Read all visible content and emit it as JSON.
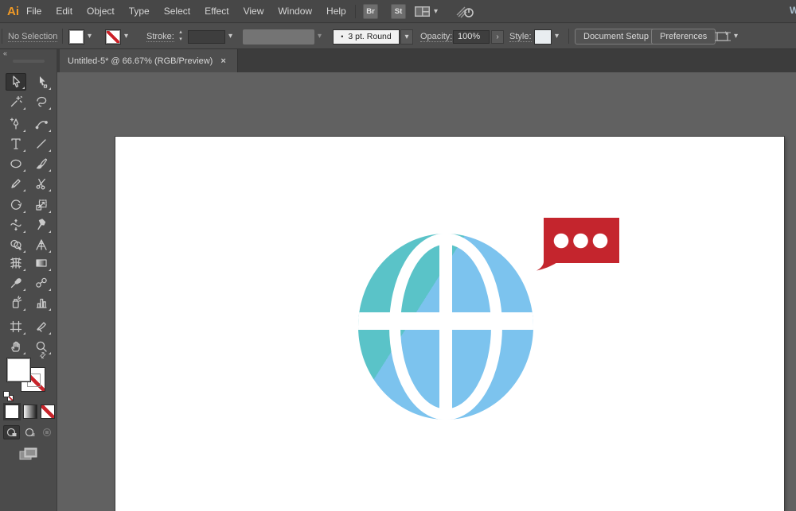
{
  "app": {
    "logo_text": "Ai",
    "workspace_cutoff_text": "W"
  },
  "menu": {
    "items": [
      "File",
      "Edit",
      "Object",
      "Type",
      "Select",
      "Effect",
      "View",
      "Window",
      "Help"
    ]
  },
  "quick_buttons": {
    "bridge": "Br",
    "stock": "St"
  },
  "glyphs": {
    "chevron_down": "▾",
    "chevron_up": "▴",
    "chevron_right": "›",
    "close": "×",
    "collapse": "«",
    "bullet": "•",
    "swap": "⇄"
  },
  "control_bar": {
    "selection_status": "No Selection",
    "stroke_label": "Stroke:",
    "brush_value": "3 pt. Round",
    "opacity_label": "Opacity:",
    "opacity_value": "100%",
    "style_label": "Style:",
    "document_setup_label": "Document Setup",
    "preferences_label": "Preferences"
  },
  "tab": {
    "title": "Untitled-5* @ 66.67% (RGB/Preview)"
  },
  "toolbar": {
    "tools": [
      "selection",
      "direct-selection",
      "magic-wand",
      "lasso",
      "pen",
      "curvature",
      "type",
      "line-segment",
      "ellipse",
      "paintbrush",
      "pencil",
      "scissors",
      "rotate",
      "scale",
      "width",
      "puppet-warp",
      "shape-builder",
      "perspective-grid",
      "mesh",
      "gradient",
      "eyedropper",
      "blend",
      "symbol-sprayer",
      "column-graph",
      "artboard",
      "slice",
      "hand",
      "zoom"
    ],
    "active_tool": "selection"
  },
  "artwork": {
    "globe": {
      "teal": "#5AC3C8",
      "blue": "#7CC3EE"
    },
    "bubble": {
      "red": "#C4252D",
      "dot_count": 3,
      "dot_color": "#FFFFFF"
    }
  },
  "colors": {
    "menubar_bg": "#474747",
    "controlbar_bg": "#4D4D4D",
    "tabbar_bg": "#3C3C3C",
    "panel_bg": "#4B4B4B",
    "canvas_bg": "#616161",
    "artboard_bg": "#FFFFFF",
    "accent_logo": "#F09A26",
    "none_slash_red": "#C8242B"
  }
}
